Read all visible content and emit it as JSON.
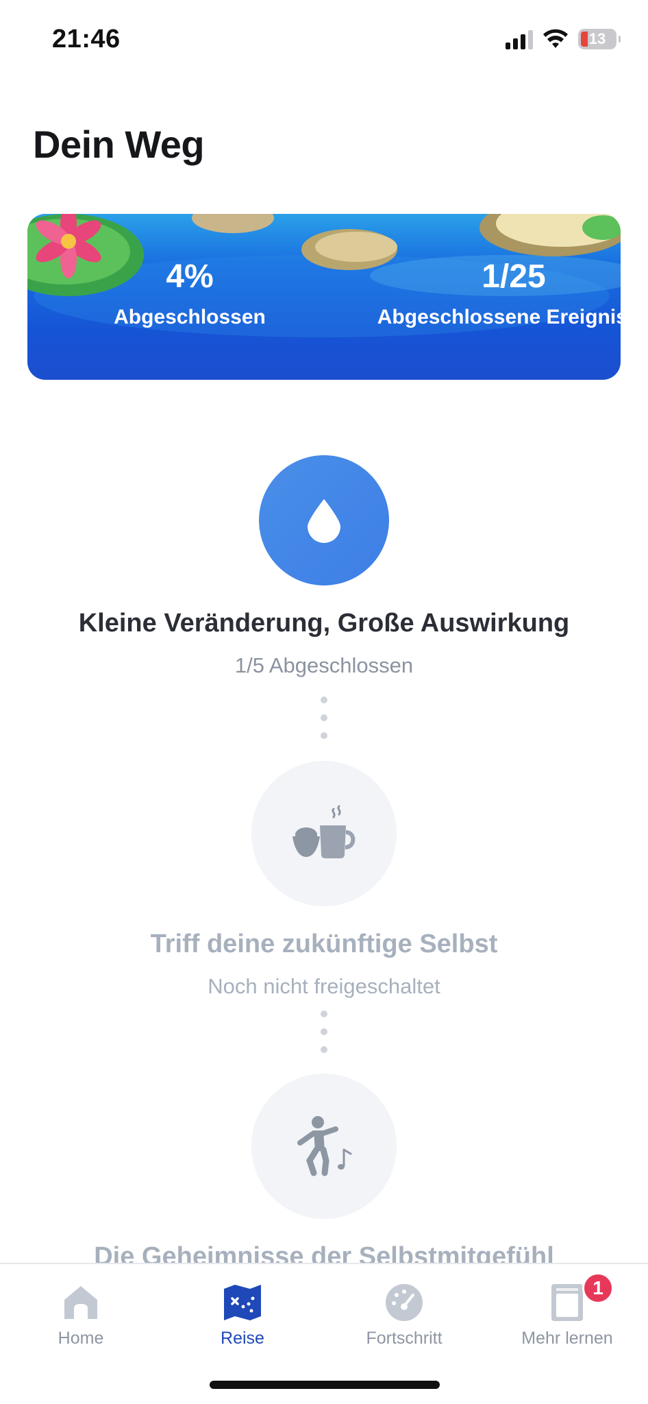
{
  "status_bar": {
    "time": "21:46",
    "battery": "13"
  },
  "header": {
    "title": "Dein Weg"
  },
  "banner": {
    "stats": [
      {
        "value": "4%",
        "label": "Abgeschlossen"
      },
      {
        "value": "1/25",
        "label": "Abgeschlossene Ereignisse"
      }
    ]
  },
  "journey": {
    "steps": [
      {
        "title": "Kleine Veränderung, Große Auswirkung",
        "status": "1/5 Abgeschlossen",
        "icon": "water-drop-icon",
        "state": "active"
      },
      {
        "title": "Triff deine zukünftige Selbst",
        "status": "Noch nicht freigeschaltet",
        "icon": "coffee-cup-icon",
        "state": "locked"
      },
      {
        "title": "Die Geheimnisse der Selbstmitgefühl",
        "icon": "dancing-person-icon",
        "state": "locked"
      }
    ]
  },
  "tabbar": {
    "tabs": [
      {
        "label": "Home",
        "icon": "home-icon"
      },
      {
        "label": "Reise",
        "icon": "map-icon",
        "active": true
      },
      {
        "label": "Fortschritt",
        "icon": "gauge-icon"
      },
      {
        "label": "Mehr lernen",
        "icon": "book-icon",
        "badge": "1"
      }
    ]
  },
  "colors": {
    "accent": "#1f49b8",
    "active_step": "#4a8fe8",
    "badge": "#e8385a",
    "locked_text": "#a7b0bd"
  }
}
